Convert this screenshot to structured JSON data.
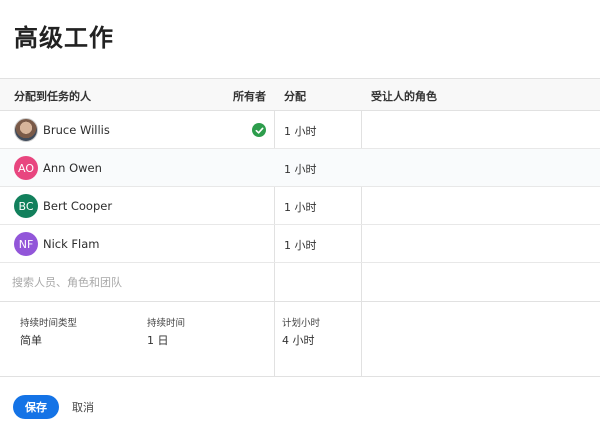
{
  "page_title": "高级工作",
  "table": {
    "columns": {
      "assignee": "分配到任务的人",
      "owner": "所有者",
      "allocation": "分配",
      "role": "受让人的角色"
    },
    "rows": [
      {
        "name": "Bruce Willis",
        "initials": "",
        "avatar_color": "",
        "is_owner": true,
        "allocation": "1 小时",
        "role": ""
      },
      {
        "name": "Ann Owen",
        "initials": "AO",
        "avatar_color": "#e8467f",
        "is_owner": false,
        "allocation": "1 小时",
        "role": ""
      },
      {
        "name": "Bert Cooper",
        "initials": "BC",
        "avatar_color": "#12805c",
        "is_owner": false,
        "allocation": "1 小时",
        "role": ""
      },
      {
        "name": "Nick Flam",
        "initials": "NF",
        "avatar_color": "#9256d9",
        "is_owner": false,
        "allocation": "1 小时",
        "role": ""
      }
    ]
  },
  "search": {
    "placeholder": "搜索人员、角色和团队",
    "value": ""
  },
  "duration": {
    "type_label": "持续时间类型",
    "type_value": "简单",
    "duration_label": "持续时间",
    "duration_value": "1 日",
    "planned_label": "计划小时",
    "planned_value": "4 小时"
  },
  "actions": {
    "save_label": "保存",
    "cancel_label": "取消"
  },
  "colors": {
    "accent": "#1473e6",
    "owner_check": "#2d9d4c"
  }
}
